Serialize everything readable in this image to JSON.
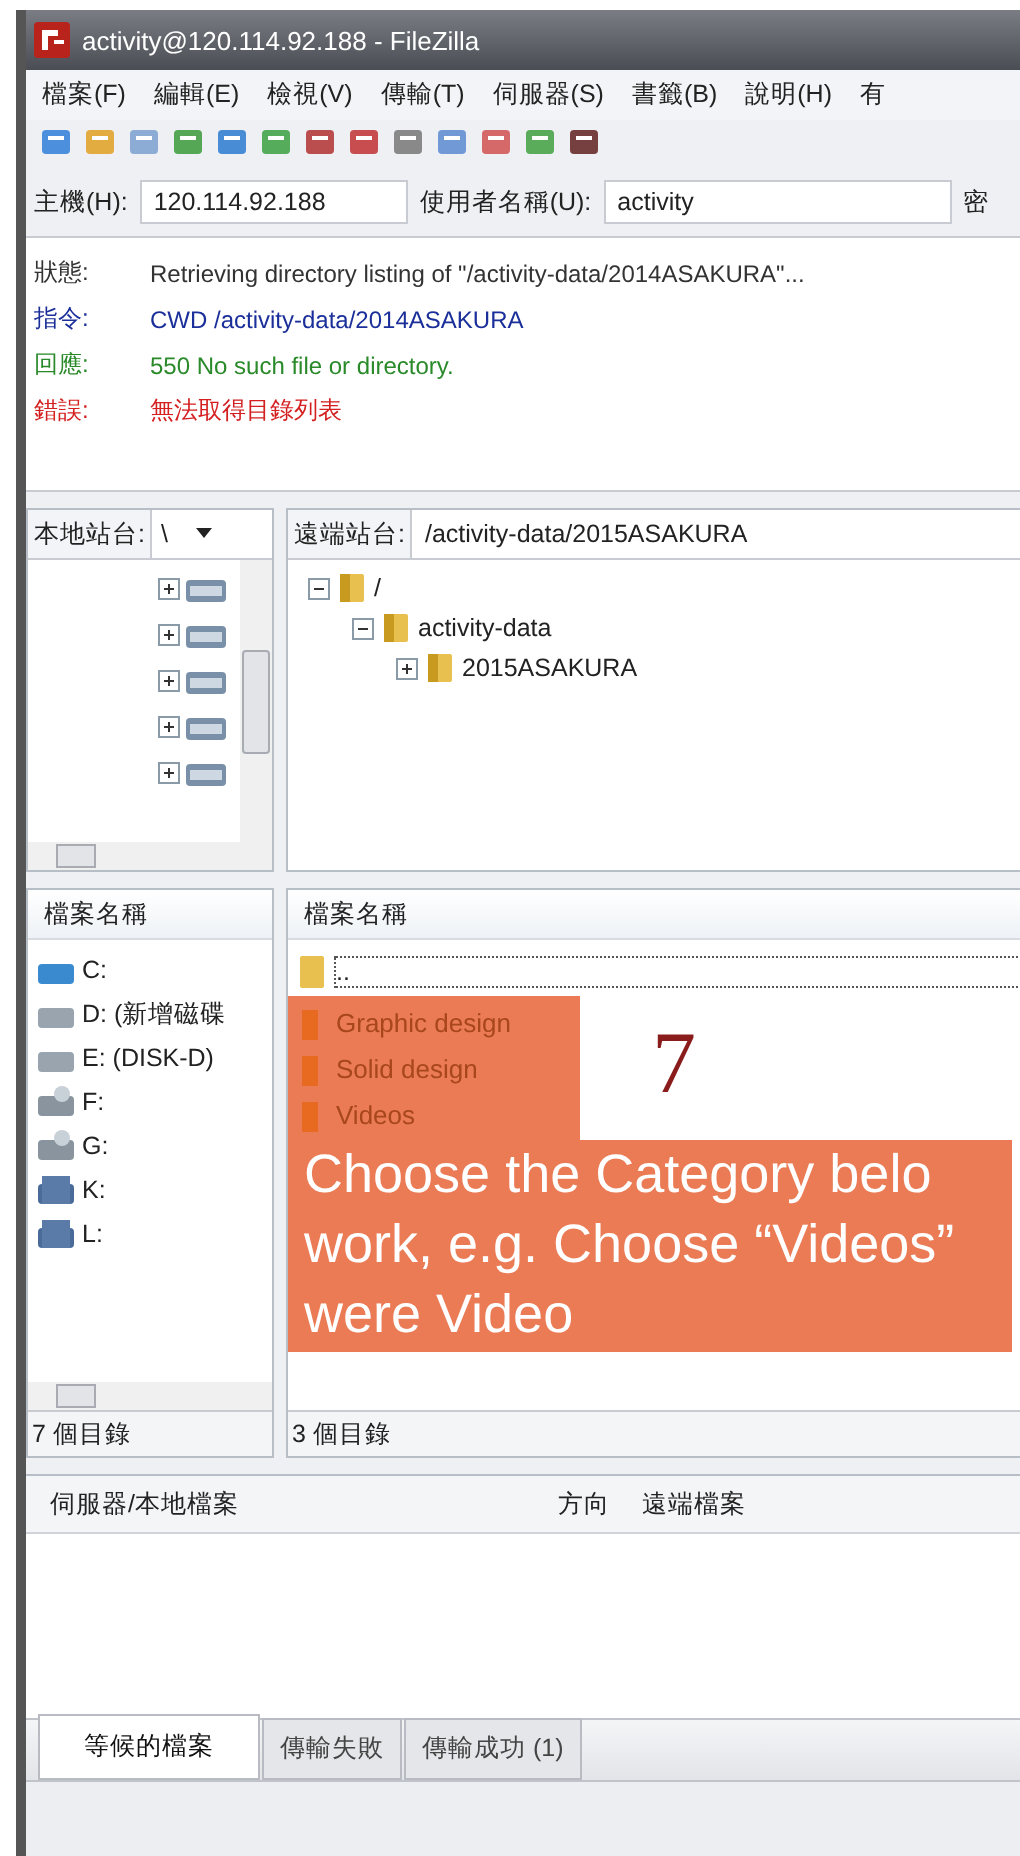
{
  "window": {
    "title": "activity@120.114.92.188 - FileZilla"
  },
  "menu": [
    "檔案(F)",
    "編輯(E)",
    "檢視(V)",
    "傳輸(T)",
    "伺服器(S)",
    "書籤(B)",
    "說明(H)",
    "有"
  ],
  "quickconnect": {
    "host_label": "主機(H):",
    "host": "120.114.92.188",
    "user_label": "使用者名稱(U):",
    "user": "activity",
    "password_label": "密"
  },
  "log": [
    {
      "kind": "status",
      "label": "狀態:",
      "text": "Retrieving directory listing of \"/activity-data/2014ASAKURA\"..."
    },
    {
      "kind": "command",
      "label": "指令:",
      "text": "CWD /activity-data/2014ASAKURA"
    },
    {
      "kind": "response",
      "label": "回應:",
      "text": "550 No such file or directory."
    },
    {
      "kind": "error",
      "label": "錯誤:",
      "text": "無法取得目錄列表"
    }
  ],
  "local_site": {
    "label": "本地站台:",
    "value": "\\"
  },
  "remote_site": {
    "label": "遠端站台:",
    "value": "/activity-data/2015ASAKURA"
  },
  "remote_tree": [
    {
      "name": "/",
      "expanded": true,
      "children": [
        {
          "name": "activity-data",
          "expanded": true,
          "children": [
            {
              "name": "2015ASAKURA",
              "expanded": false
            }
          ]
        }
      ]
    }
  ],
  "local_files": {
    "column": "檔案名稱",
    "items": [
      {
        "name": "C:",
        "kind": "system"
      },
      {
        "name": "D: (新增磁碟",
        "kind": "disk"
      },
      {
        "name": "E: (DISK-D)",
        "kind": "disk"
      },
      {
        "name": "F:",
        "kind": "removable"
      },
      {
        "name": "G:",
        "kind": "removable"
      },
      {
        "name": "K:",
        "kind": "cf"
      },
      {
        "name": "L:",
        "kind": "sd"
      }
    ],
    "status": "7 個目錄"
  },
  "remote_files": {
    "column": "檔案名稱",
    "items": [
      {
        "name": ".."
      },
      {
        "name": "Graphic design"
      },
      {
        "name": "Solid design"
      },
      {
        "name": "Videos"
      }
    ],
    "status": "3 個目錄"
  },
  "annotation": {
    "step": "7",
    "lines": [
      "Choose the Category belo",
      "work, e.g. Choose “Videos”",
      "were Video"
    ]
  },
  "queue": {
    "columns": [
      "伺服器/本地檔案",
      "方向",
      "遠端檔案"
    ],
    "tabs": [
      {
        "label": "等候的檔案",
        "selected": true
      },
      {
        "label": "傳輸失敗",
        "selected": false
      },
      {
        "label": "傳輸成功 (1)",
        "selected": false
      }
    ]
  }
}
